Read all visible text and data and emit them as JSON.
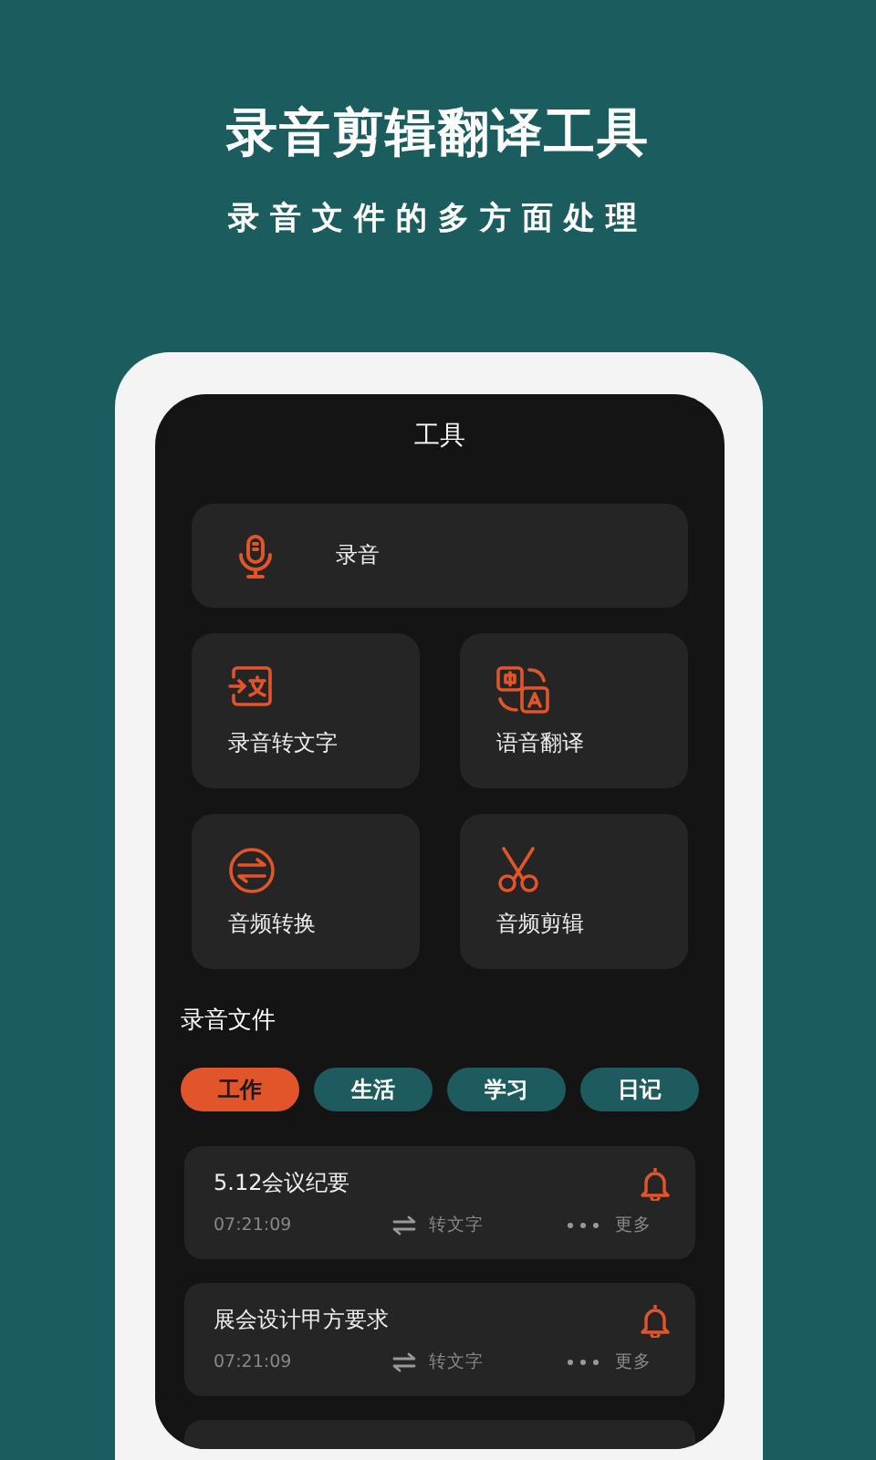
{
  "header": {
    "title": "录音剪辑翻译工具",
    "subtitle": "录音文件的多方面处理"
  },
  "screen": {
    "title": "工具",
    "tools": [
      {
        "kind": "wide",
        "label": "录音"
      },
      {
        "kind": "square",
        "label": "录音转文字"
      },
      {
        "kind": "square",
        "label": "语音翻译"
      },
      {
        "kind": "square",
        "label": "音频转换"
      },
      {
        "kind": "square",
        "label": "音频剪辑"
      }
    ],
    "section_title": "录音文件",
    "categories": [
      {
        "label": "工作",
        "selected": true
      },
      {
        "label": "生活",
        "selected": false
      },
      {
        "label": "学习",
        "selected": false
      },
      {
        "label": "日记",
        "selected": false
      }
    ],
    "files": [
      {
        "title": "5.12会议纪要",
        "time": "07:21:09",
        "convert": "转文字",
        "more": "更多"
      },
      {
        "title": "展会设计甲方要求",
        "time": "07:21:09",
        "convert": "转文字",
        "more": "更多"
      }
    ]
  }
}
